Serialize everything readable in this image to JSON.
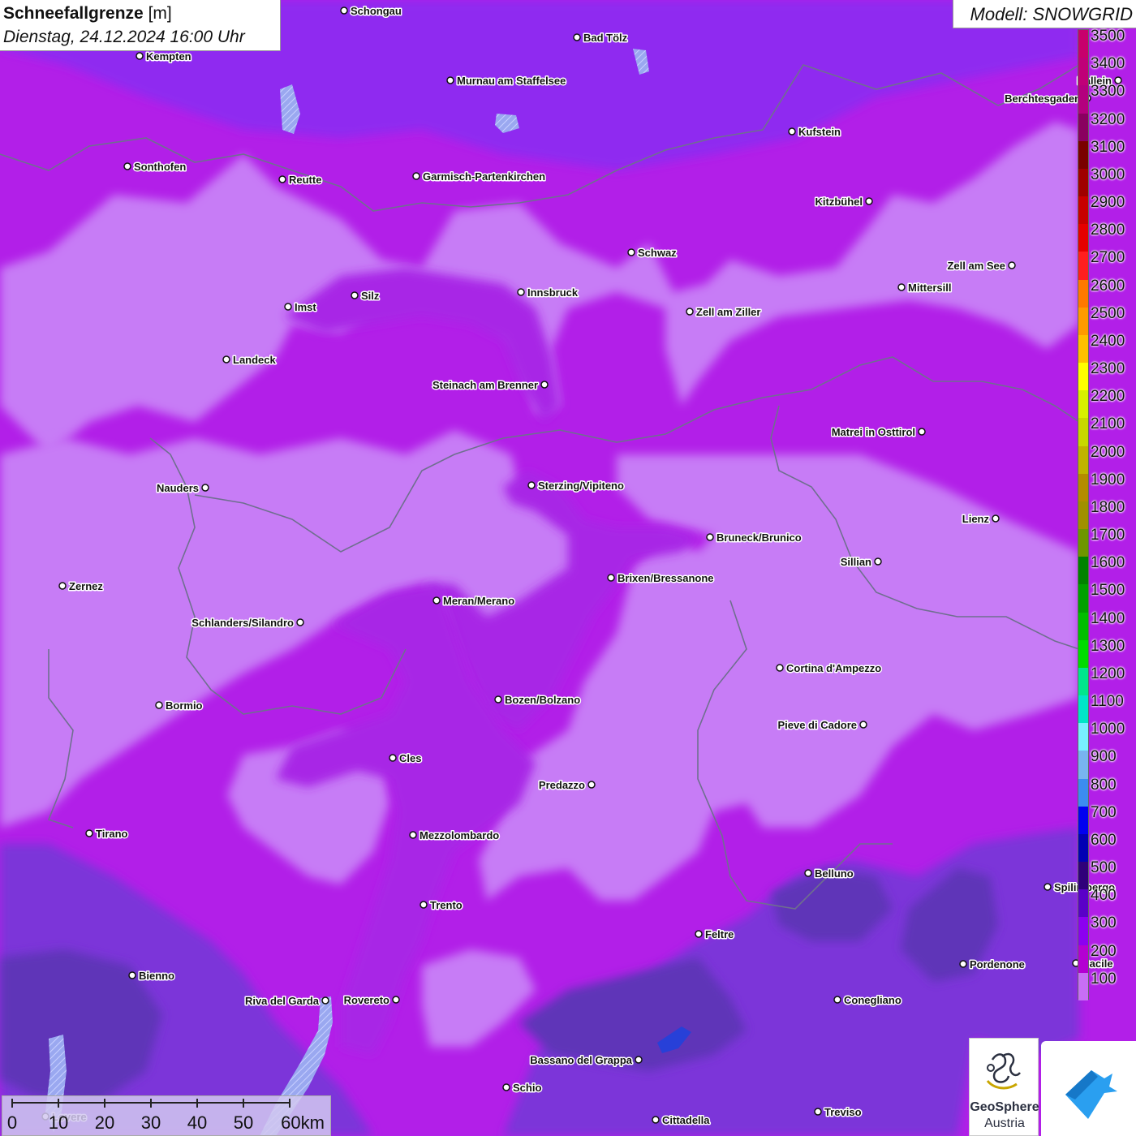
{
  "header": {
    "title": "Schneefallgrenze",
    "unit": "[m]",
    "datetime": "Dienstag, 24.12.2024 16:00 Uhr"
  },
  "model_label": "Modell: SNOWGRID",
  "legend": {
    "unit": "m",
    "steps": [
      {
        "value": "3500",
        "color": "#c8006c"
      },
      {
        "value": "3400",
        "color": "#c00078"
      },
      {
        "value": "3300",
        "color": "#b4007e"
      },
      {
        "value": "3200",
        "color": "#8a0060"
      },
      {
        "value": "3100",
        "color": "#7a0000"
      },
      {
        "value": "3000",
        "color": "#a00000"
      },
      {
        "value": "2900",
        "color": "#c80000"
      },
      {
        "value": "2800",
        "color": "#e60000"
      },
      {
        "value": "2700",
        "color": "#ff1e1e"
      },
      {
        "value": "2600",
        "color": "#ff7800"
      },
      {
        "value": "2500",
        "color": "#ff9a00"
      },
      {
        "value": "2400",
        "color": "#ffc000"
      },
      {
        "value": "2300",
        "color": "#ffff00"
      },
      {
        "value": "2200",
        "color": "#d8f000"
      },
      {
        "value": "2100",
        "color": "#c8d800"
      },
      {
        "value": "2000",
        "color": "#c0b400"
      },
      {
        "value": "1900",
        "color": "#b48c00"
      },
      {
        "value": "1800",
        "color": "#a09000"
      },
      {
        "value": "1700",
        "color": "#6e9600"
      },
      {
        "value": "1600",
        "color": "#008200"
      },
      {
        "value": "1500",
        "color": "#00a000"
      },
      {
        "value": "1400",
        "color": "#00be00"
      },
      {
        "value": "1300",
        "color": "#00dc00"
      },
      {
        "value": "1200",
        "color": "#00e68c"
      },
      {
        "value": "1100",
        "color": "#00e6c8"
      },
      {
        "value": "1000",
        "color": "#78f0ff"
      },
      {
        "value": "900",
        "color": "#78b4f0"
      },
      {
        "value": "800",
        "color": "#3c8cf0"
      },
      {
        "value": "700",
        "color": "#0000f0"
      },
      {
        "value": "600",
        "color": "#0000b4"
      },
      {
        "value": "500",
        "color": "#30007a"
      },
      {
        "value": "400",
        "color": "#5a00c8"
      },
      {
        "value": "300",
        "color": "#8c00f0"
      },
      {
        "value": "200",
        "color": "#b400d2"
      },
      {
        "value": "100",
        "color": "#c86ef5"
      }
    ]
  },
  "cities": [
    {
      "name": "Schongau",
      "anchor": "start"
    },
    {
      "name": "Bad Tölz",
      "anchor": "start"
    },
    {
      "name": "Kempten",
      "anchor": "start"
    },
    {
      "name": "Murnau am Staffelsee",
      "anchor": "start"
    },
    {
      "name": "Hallein",
      "anchor": "end"
    },
    {
      "name": "Berchtesgaden",
      "anchor": "end"
    },
    {
      "name": "Kufstein",
      "anchor": "start"
    },
    {
      "name": "Sonthofen",
      "anchor": "start"
    },
    {
      "name": "Reutte",
      "anchor": "start"
    },
    {
      "name": "Garmisch-Partenkirchen",
      "anchor": "start"
    },
    {
      "name": "Kitzbühel",
      "anchor": "end"
    },
    {
      "name": "Schwaz",
      "anchor": "start"
    },
    {
      "name": "Zell am See",
      "anchor": "end"
    },
    {
      "name": "Innsbruck",
      "anchor": "start"
    },
    {
      "name": "Silz",
      "anchor": "start"
    },
    {
      "name": "Mittersill",
      "anchor": "start"
    },
    {
      "name": "Imst",
      "anchor": "start"
    },
    {
      "name": "Zell am Ziller",
      "anchor": "start"
    },
    {
      "name": "Landeck",
      "anchor": "start"
    },
    {
      "name": "Steinach am Brenner",
      "anchor": "end"
    },
    {
      "name": "Matrei in Osttirol",
      "anchor": "end"
    },
    {
      "name": "Nauders",
      "anchor": "end"
    },
    {
      "name": "Sterzing/Vipiteno",
      "anchor": "start"
    },
    {
      "name": "Lienz",
      "anchor": "end"
    },
    {
      "name": "Bruneck/Brunico",
      "anchor": "start"
    },
    {
      "name": "Sillian",
      "anchor": "end"
    },
    {
      "name": "Brixen/Bressanone",
      "anchor": "start"
    },
    {
      "name": "Zernez",
      "anchor": "start"
    },
    {
      "name": "Meran/Merano",
      "anchor": "start"
    },
    {
      "name": "Schlanders/Silandro",
      "anchor": "end"
    },
    {
      "name": "Cortina d'Ampezzo",
      "anchor": "start"
    },
    {
      "name": "Bozen/Bolzano",
      "anchor": "start"
    },
    {
      "name": "Bormio",
      "anchor": "start"
    },
    {
      "name": "Pieve di Cadore",
      "anchor": "end"
    },
    {
      "name": "Cles",
      "anchor": "start"
    },
    {
      "name": "Predazzo",
      "anchor": "end"
    },
    {
      "name": "Tirano",
      "anchor": "start"
    },
    {
      "name": "Mezzolombardo",
      "anchor": "start"
    },
    {
      "name": "Belluno",
      "anchor": "start"
    },
    {
      "name": "Spilimbergo",
      "anchor": "start"
    },
    {
      "name": "Trento",
      "anchor": "start"
    },
    {
      "name": "Feltre",
      "anchor": "start"
    },
    {
      "name": "Pordenone",
      "anchor": "start"
    },
    {
      "name": "Bienno",
      "anchor": "start"
    },
    {
      "name": "Riva del Garda",
      "anchor": "end"
    },
    {
      "name": "Rovereto",
      "anchor": "end"
    },
    {
      "name": "Conegliano",
      "anchor": "start"
    },
    {
      "name": "Bassano del Grappa",
      "anchor": "end"
    },
    {
      "name": "Schio",
      "anchor": "start"
    },
    {
      "name": "Treviso",
      "anchor": "start"
    },
    {
      "name": "Cittadella",
      "anchor": "start"
    },
    {
      "name": "Lovere",
      "anchor": "start"
    },
    {
      "name": "Sacile",
      "anchor": "start"
    }
  ],
  "scale_bar": {
    "labels": [
      "0",
      "10",
      "20",
      "30",
      "40",
      "50",
      "60km"
    ]
  },
  "logos": {
    "geosphere_line1": "GeoSphere",
    "geosphere_line2": "Austria"
  }
}
